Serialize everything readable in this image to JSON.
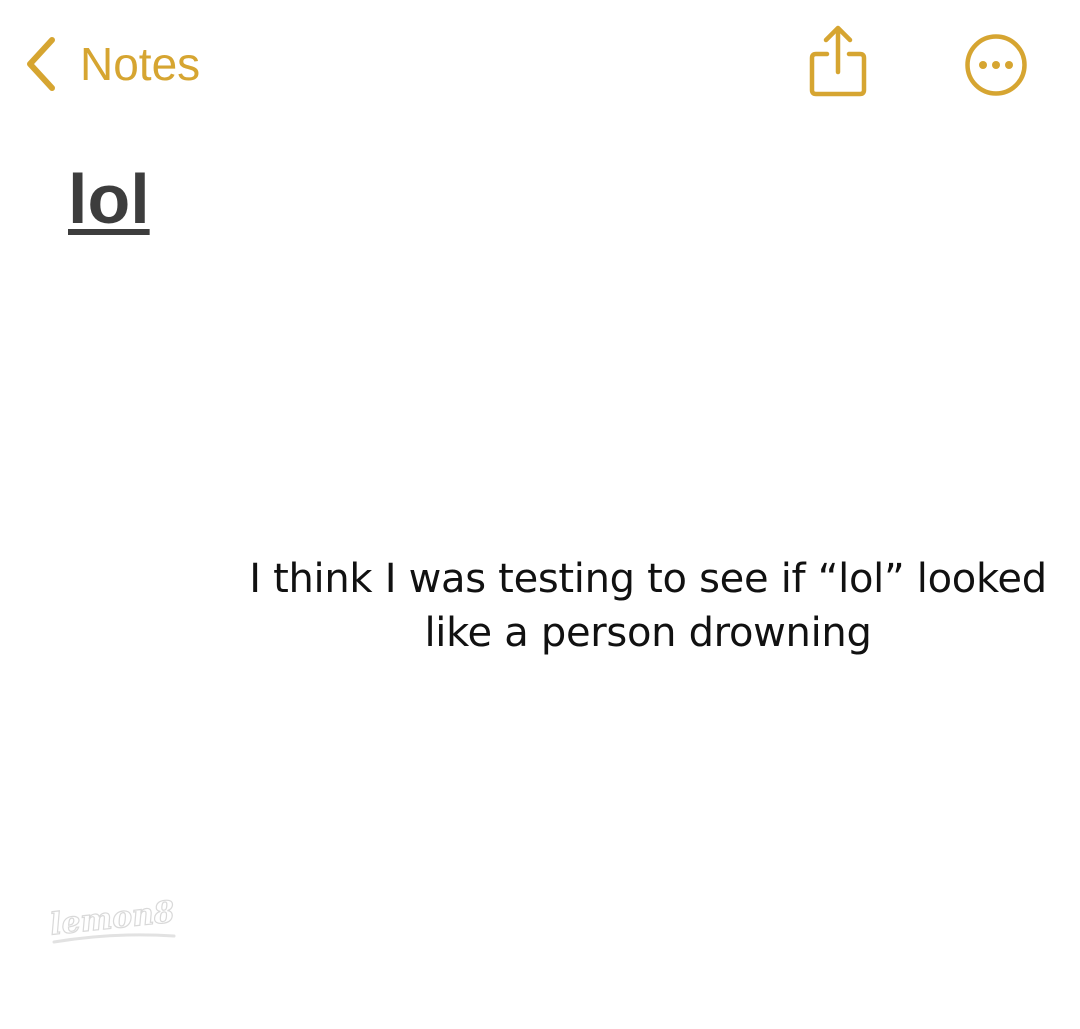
{
  "nav": {
    "back_label": "Notes",
    "back_icon": "chevron-left-icon",
    "share_icon": "share-icon",
    "more_icon": "ellipsis-circle-icon",
    "accent_color": "#d6a531"
  },
  "note": {
    "title": "lol"
  },
  "caption": {
    "text": "I think I was testing to see if “lol” looked like a person drowning"
  },
  "watermark": {
    "text": "lemon8"
  }
}
